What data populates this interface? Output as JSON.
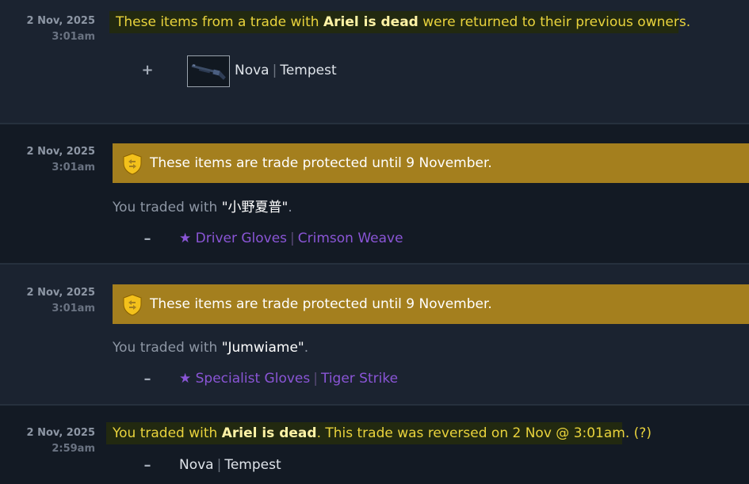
{
  "entries": [
    {
      "date": "2 Nov, 2025",
      "time": "3:01am",
      "notice_pre": "These items from a trade with ",
      "notice_name": "Ariel is dead",
      "notice_post": " were returned to their previous owners.",
      "item_sign": "+",
      "item_name": "Nova",
      "item_skin": "Tempest",
      "item_icon": "shotgun-icon"
    },
    {
      "date": "2 Nov, 2025",
      "time": "3:01am",
      "protect_text": "These items are trade protected until 9 November.",
      "traded_pre": "You traded with ",
      "traded_name": "\"小野夏普\"",
      "traded_post": ".",
      "item_sign": "–",
      "item_name": "★ Driver Gloves",
      "item_skin": "Crimson Weave"
    },
    {
      "date": "2 Nov, 2025",
      "time": "3:01am",
      "protect_text": "These items are trade protected until 9 November.",
      "traded_pre": "You traded with ",
      "traded_name": "\"Jumwiame\"",
      "traded_post": ".",
      "item_sign": "–",
      "item_name": "★ Specialist Gloves",
      "item_skin": "Tiger Strike"
    },
    {
      "date": "2 Nov, 2025",
      "time": "2:59am",
      "notice_pre": "You traded with ",
      "notice_name": "Ariel is dead",
      "notice_post": ". This trade was reversed on 2 Nov @ 3:01am. (?)",
      "item_sign": "–",
      "item_name": "Nova",
      "item_skin": "Tempest"
    }
  ],
  "colors": {
    "protect_banner": "#a47f1e",
    "notice_text": "#e9d33c",
    "rarity_purple": "#8a55d6"
  },
  "icons": {
    "protect": "trade-protected-shield-icon"
  }
}
